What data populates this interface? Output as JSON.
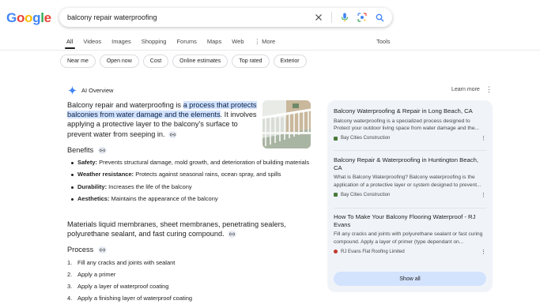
{
  "logo": {
    "letters": [
      "G",
      "o",
      "o",
      "g",
      "l",
      "e"
    ],
    "colors": [
      "#4285F4",
      "#EA4335",
      "#FBBC05",
      "#4285F4",
      "#34A853",
      "#EA4335"
    ]
  },
  "search": {
    "query": "balcony repair waterproofing"
  },
  "tabs": [
    "All",
    "Videos",
    "Images",
    "Shopping",
    "Forums",
    "Maps",
    "Web",
    "More"
  ],
  "tools_label": "Tools",
  "chips": [
    "Near me",
    "Open now",
    "Cost",
    "Online estimates",
    "Top rated",
    "Exterior"
  ],
  "ai_overview": {
    "title": "AI Overview",
    "learn_more": "Learn more",
    "intro_prefix": "Balcony repair and waterproofing is ",
    "intro_highlight": "a process that protects balconies from water damage and the elements",
    "intro_suffix": ". It involves applying a protective layer to the balcony's surface to prevent water from seeping in.",
    "benefits_heading": "Benefits",
    "benefits": [
      {
        "term": "Safety:",
        "text": " Prevents structural damage, mold growth, and deterioration of building materials"
      },
      {
        "term": "Weather resistance:",
        "text": " Protects against seasonal rains, ocean spray, and spills"
      },
      {
        "term": "Durability:",
        "text": " Increases the life of the balcony"
      },
      {
        "term": "Aesthetics:",
        "text": " Maintains the appearance of the balcony"
      }
    ],
    "materials": "Materials liquid membranes, sheet membranes, penetrating sealers, polyurethane sealant, and fast curing compound.",
    "process_heading": "Process",
    "process": [
      {
        "num": "1.",
        "text": "Fill any cracks and joints with sealant"
      },
      {
        "num": "2.",
        "text": "Apply a primer"
      },
      {
        "num": "3.",
        "text": "Apply a layer of waterproof coating"
      },
      {
        "num": "4.",
        "text": "Apply a finishing layer of waterproof coating"
      }
    ]
  },
  "sources": [
    {
      "title": "Balcony Waterproofing & Repair in Long Beach, CA",
      "snippet": "Protect your outdoor living space from water damage and the...",
      "snippet_line1": "Balcony waterproofing is a specialized process designed to",
      "site": "Bay Cities Construction",
      "fav_color": "#4a7a3a"
    },
    {
      "title": "Balcony Repair & Waterproofing in Huntington Beach, CA",
      "snippet_line1": "What is Balcony Waterproofing? Balcony waterproofing is the",
      "snippet": "application of a protective layer or system designed to prevent...",
      "site": "Bay Cities Construction",
      "fav_color": "#4a7a3a"
    },
    {
      "title": "How To Make Your Balcony Flooring Waterproof - RJ Evans",
      "snippet_line1": "Fill any cracks and joints with polyurethane sealant or fast",
      "snippet": "curing compound. Apply a layer of primer (type dependant on...",
      "site": "RJ Evans Flat Roofing Limited",
      "fav_color": "#c0392b"
    }
  ],
  "show_all": "Show all",
  "colors": {
    "highlight_bg": "#d3e3fd",
    "panel_bg": "#f0f4f9",
    "ai_star": "#4285F4"
  }
}
